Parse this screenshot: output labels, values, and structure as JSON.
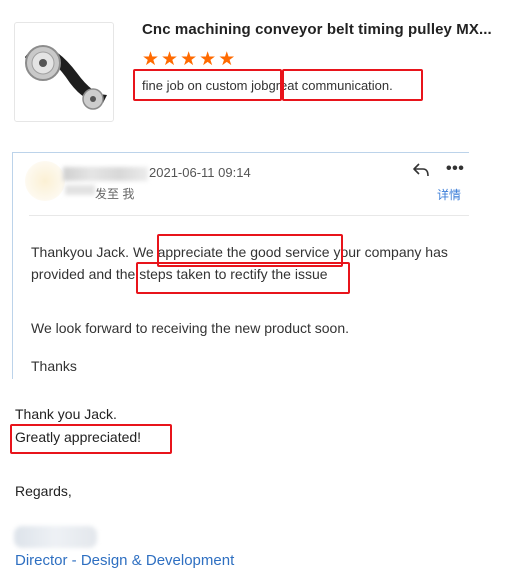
{
  "product": {
    "title": "Cnc machining conveyor belt timing pulley MX...",
    "rating_stars": 5,
    "review_part1": "fine job on custom job",
    "review_part2": "great communication."
  },
  "email": {
    "date": "2021-06-11 09:14",
    "to_label": "发至 我",
    "details_link": "详情",
    "line1a": "Thankyou Jack. We ",
    "line1b": "appreciate the good service",
    "line1c": " your company has",
    "line2a": "provided and the ",
    "line2b": "steps taken to rectify the issue",
    "para2": "We look forward to receiving the new product soon.",
    "para3": "Thanks"
  },
  "reply": {
    "line1": "Thank you Jack.",
    "line2": "Greatly appreciated!",
    "regards": "Regards,",
    "signature_title": "Director - Design & Development"
  },
  "colors": {
    "accent_star": "#ff6a00",
    "highlight_box": "#e8141b",
    "link": "#3b7dd8",
    "signature": "#2e6fc1"
  }
}
